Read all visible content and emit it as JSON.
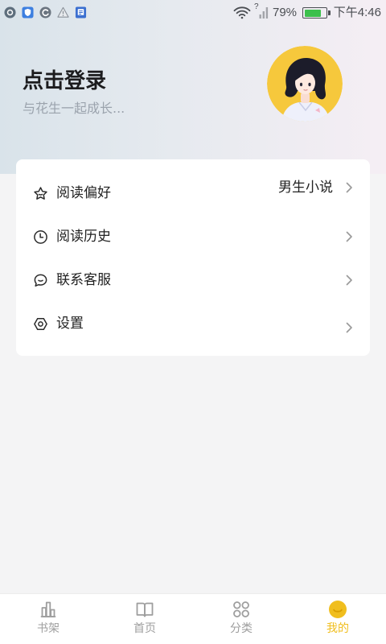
{
  "status_bar": {
    "notification_icons": [
      "app-circle-icon",
      "shield-icon",
      "sync-icon",
      "warning-icon",
      "document-icon"
    ],
    "signal_label": "?",
    "battery_percent": "79%",
    "battery_level": 0.79,
    "time": "下午4:46"
  },
  "profile": {
    "title": "点击登录",
    "subtitle": "与花生一起成长...",
    "avatar_icon": "girl-avatar-illustration"
  },
  "menu": {
    "items": [
      {
        "icon": "star-icon",
        "label": "阅读偏好",
        "value": "男生小说"
      },
      {
        "icon": "clock-icon",
        "label": "阅读历史"
      },
      {
        "icon": "chat-icon",
        "label": "联系客服"
      },
      {
        "icon": "settings-icon",
        "label": "设置"
      }
    ]
  },
  "tab_bar": {
    "active_index": 3,
    "tabs": [
      {
        "icon": "bookshelf-icon",
        "label": "书架"
      },
      {
        "icon": "book-icon",
        "label": "首页"
      },
      {
        "icon": "category-icon",
        "label": "分类"
      },
      {
        "icon": "smile-icon",
        "label": "我的"
      }
    ]
  },
  "colors": {
    "accent": "#f0be1e",
    "avatar_bg": "#f6c83c",
    "text_primary": "#222222",
    "text_secondary": "#9ba3ad",
    "tab_inactive": "#9e9e9e",
    "battery": "#3cc04c"
  }
}
